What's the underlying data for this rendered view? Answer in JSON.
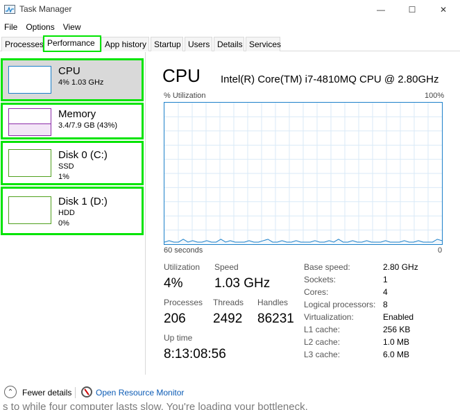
{
  "window": {
    "title": "Task Manager",
    "minimize_glyph": "—",
    "maximize_glyph": "☐",
    "close_glyph": "✕"
  },
  "menu": [
    "File",
    "Options",
    "View"
  ],
  "tabs": [
    {
      "label": "Processes",
      "active": false
    },
    {
      "label": "Performance",
      "active": true
    },
    {
      "label": "App history",
      "active": false
    },
    {
      "label": "Startup",
      "active": false
    },
    {
      "label": "Users",
      "active": false
    },
    {
      "label": "Details",
      "active": false
    },
    {
      "label": "Services",
      "active": false
    }
  ],
  "resources": [
    {
      "name": "CPU",
      "lines": [
        "4%  1.03 GHz"
      ],
      "color": "#1a7fc9",
      "selected": true
    },
    {
      "name": "Memory",
      "lines": [
        "3.4/7.9 GB (43%)"
      ],
      "color": "#8b2aa8",
      "selected": false
    },
    {
      "name": "Disk 0 (C:)",
      "lines": [
        "SSD",
        "1%"
      ],
      "color": "#4ea01c",
      "selected": false
    },
    {
      "name": "Disk 1 (D:)",
      "lines": [
        "HDD",
        "0%"
      ],
      "color": "#4ea01c",
      "selected": false
    }
  ],
  "detail": {
    "title": "CPU",
    "model": "Intel(R) Core(TM) i7-4810MQ CPU @ 2.80GHz",
    "graph_label": "% Utilization",
    "graph_max": "100%",
    "axis_left": "60 seconds",
    "axis_right": "0",
    "graph_color": "#1a7fc9",
    "utilization_samples": [
      1,
      2,
      1,
      1,
      3,
      1,
      2,
      1,
      1,
      2,
      1,
      1,
      3,
      1,
      2,
      1,
      1,
      1,
      2,
      1,
      1,
      2,
      3,
      1,
      1,
      2,
      1,
      1,
      2,
      1,
      1,
      1,
      2,
      1,
      1,
      2,
      1,
      3,
      1,
      1,
      2,
      1,
      1,
      2,
      1,
      1,
      1,
      2,
      1,
      1,
      1,
      2,
      1,
      1,
      2,
      1,
      1,
      1,
      3,
      2
    ],
    "stats": {
      "utilization_label": "Utilization",
      "utilization_value": "4%",
      "speed_label": "Speed",
      "speed_value": "1.03 GHz",
      "processes_label": "Processes",
      "processes_value": "206",
      "threads_label": "Threads",
      "threads_value": "2492",
      "handles_label": "Handles",
      "handles_value": "86231",
      "uptime_label": "Up time",
      "uptime_value": "8:13:08:56"
    },
    "specs": [
      {
        "key": "Base speed:",
        "value": "2.80 GHz"
      },
      {
        "key": "Sockets:",
        "value": "1"
      },
      {
        "key": "Cores:",
        "value": "4"
      },
      {
        "key": "Logical processors:",
        "value": "8"
      },
      {
        "key": "Virtualization:",
        "value": "Enabled"
      },
      {
        "key": "L1 cache:",
        "value": "256 KB"
      },
      {
        "key": "L2 cache:",
        "value": "1.0 MB"
      },
      {
        "key": "L3 cache:",
        "value": "6.0 MB"
      }
    ]
  },
  "footer": {
    "fewer_details": "Fewer details",
    "open_resource_monitor": "Open Resource Monitor",
    "overflow_text": "s to while four computer lasts slow. You're loading your bottleneck."
  }
}
